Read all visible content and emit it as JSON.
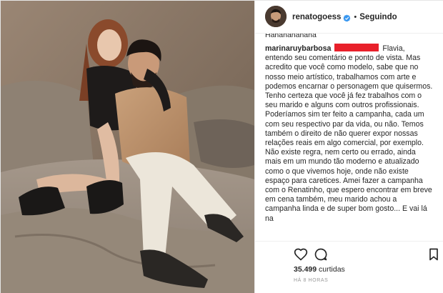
{
  "post": {
    "username": "renatogoess",
    "follow_status": "Seguindo",
    "separator": "•",
    "previous_comment_fragment": "Hahahahahaha"
  },
  "comment": {
    "username": "marinaruybarbosa",
    "text": "Flavia, entendo seu comentário e ponto de vista. Mas acredito que você como modelo, sabe que no nosso meio artístico, trabalhamos com arte e podemos encarnar o personagem que quisermos. Tenho certeza que você já fez trabalhos com o seu marido e alguns com outros profissionais. Poderíamos sim ter feito a campanha, cada um com seu respectivo par da vida, ou não. Temos também o direito de não querer expor nossas relações reais em algo comercial, por exemplo. Não existe regra, nem certo ou errado, ainda mais em um mundo tão moderno e atualizado como o que vivemos hoje, onde não existe espaço para caretices. Amei fazer a campanha com o Renatinho, que espero encontrar em breve em cena também, meu marido achou a campanha linda e de super bom gosto... E vai lá na"
  },
  "stats": {
    "likes_count": "35.499",
    "likes_label": "curtidas",
    "timestamp": "HÁ 8 HORAS"
  },
  "icons": {
    "like": "heart-icon",
    "comment": "comment-bubble-icon",
    "save": "bookmark-icon",
    "verified": "verified-badge-icon"
  },
  "colors": {
    "verified": "#3897f0",
    "redaction": "#e8202a",
    "muted": "#999999",
    "text": "#262626"
  }
}
